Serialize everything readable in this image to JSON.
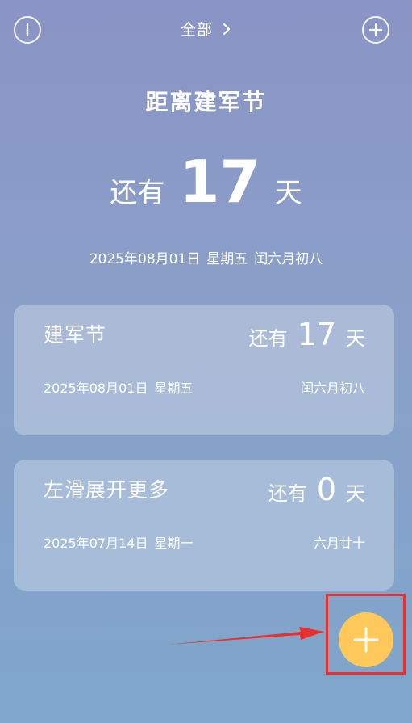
{
  "top_bar": {
    "filter_label": "全部",
    "info_icon": "info-icon",
    "add_icon": "plus-circle-icon"
  },
  "hero": {
    "title": "距离建军节",
    "prefix": "还有",
    "days": "17",
    "suffix": "天",
    "date": "2025年08月01日",
    "weekday": "星期五",
    "lunar": "闰六月初八"
  },
  "cards": [
    {
      "name": "建军节",
      "prefix": "还有",
      "days": "17",
      "suffix": "天",
      "date": "2025年08月01日",
      "weekday": "星期五",
      "lunar": "闰六月初八"
    },
    {
      "name": "左滑展开更多",
      "prefix": "还有",
      "days": "0",
      "suffix": "天",
      "date": "2025年07月14日",
      "weekday": "星期一",
      "lunar": "六月廿十"
    }
  ],
  "fab": {
    "icon": "plus-icon",
    "color": "#ffc85a"
  },
  "colors": {
    "background_top": "#8a94c6",
    "background_bottom": "#7fa6cb",
    "annotation": "#e8312e"
  }
}
